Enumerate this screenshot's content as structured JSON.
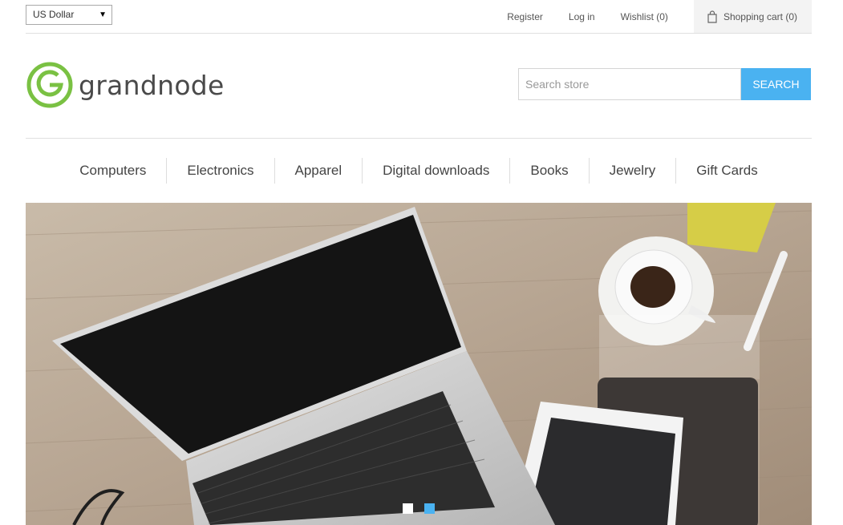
{
  "topbar": {
    "currency": "US Dollar",
    "register": "Register",
    "login": "Log in",
    "wishlist": "Wishlist (0)",
    "cart": "Shopping cart (0)"
  },
  "header": {
    "logo_text": "grandnode",
    "logo_color": "#7ac143",
    "search_placeholder": "Search store",
    "search_button": "SEARCH",
    "accent": "#4ab2f1"
  },
  "menu": {
    "items": [
      "Computers",
      "Electronics",
      "Apparel",
      "Digital downloads",
      "Books",
      "Jewelry",
      "Gift Cards"
    ]
  },
  "slider": {
    "slides": 2,
    "active_slide": 2,
    "dot_inactive_color": "#ffffff",
    "dot_active_color": "#4ab2f1"
  }
}
